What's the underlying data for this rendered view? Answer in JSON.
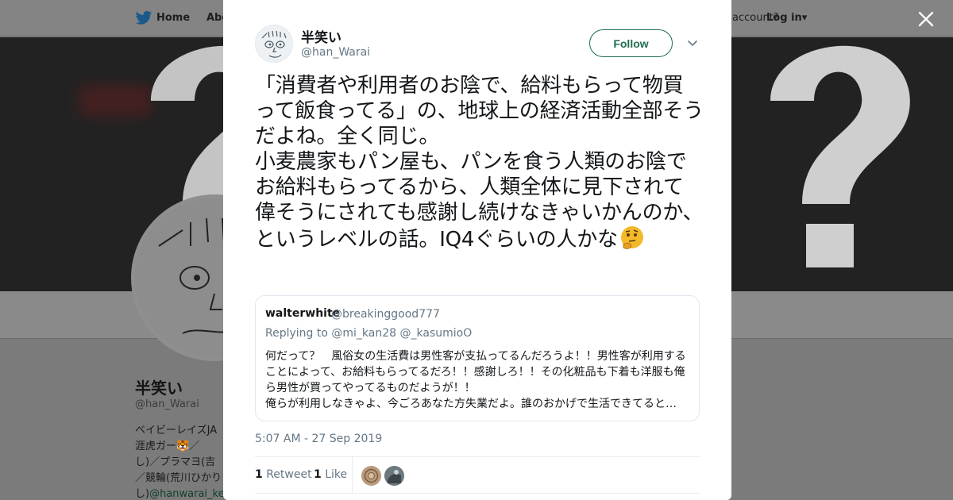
{
  "background": {
    "nav": {
      "home": "Home",
      "about": "Abo",
      "account": "account?",
      "login": "Log in"
    },
    "profile": {
      "name": "半笑い",
      "handle": "@han_Warai",
      "bio_lines": [
        "ベイビーレイズJA",
        "涯虎ガー🐯／",
        "し)／プラマヨ(吉",
        "／競輪(荒川ひかり"
      ],
      "bio_link_prefix": "し)",
      "bio_link": "@hanwarai_ke"
    }
  },
  "tweet": {
    "author_name": "半笑い",
    "author_handle": "@han_Warai",
    "follow_label": "Follow",
    "text": "「消費者や利用者のお陰で、給料もらって物買って飯食ってる」の、地球上の経済活動全部そうだよね。全く同じ。\n小麦農家もパン屋も、パンを食う人類のお陰でお給料もらってるから、人類全体に見下されて偉そうにされても感謝し続けなきゃいかんのか、というレベルの話。IQ4ぐらいの人かな",
    "emoji_icon": "thinking-face-icon",
    "timestamp": "5:07 AM - 27 Sep 2019",
    "retweet_count": "1",
    "retweet_label": "Retweet",
    "like_count": "1",
    "like_label": "Like"
  },
  "quoted": {
    "author_name": "walterwhite",
    "author_handle": "@breakinggood777",
    "replying_prefix": "Replying to",
    "replying_to_1": "@mi_kan28",
    "replying_to_2": "@_kasumioO",
    "text": "何だって？　風俗女の生活費は男性客が支払ってるんだろうよ！！男性客が利用することによって、お給料もらってるだろ！！感謝しろ！！その化粧品も下着も洋服も俺ら男性が買ってやってるものだようが！！\n俺らが利用しなきゃよ、今ごろあなた方失業だよ。誰のおかげで生活できてると…"
  },
  "colors": {
    "follow_green": "#1d6e4f",
    "secondary_text": "#657786",
    "primary_text": "#14171a",
    "overlay_gray": "#7b7b7b"
  }
}
